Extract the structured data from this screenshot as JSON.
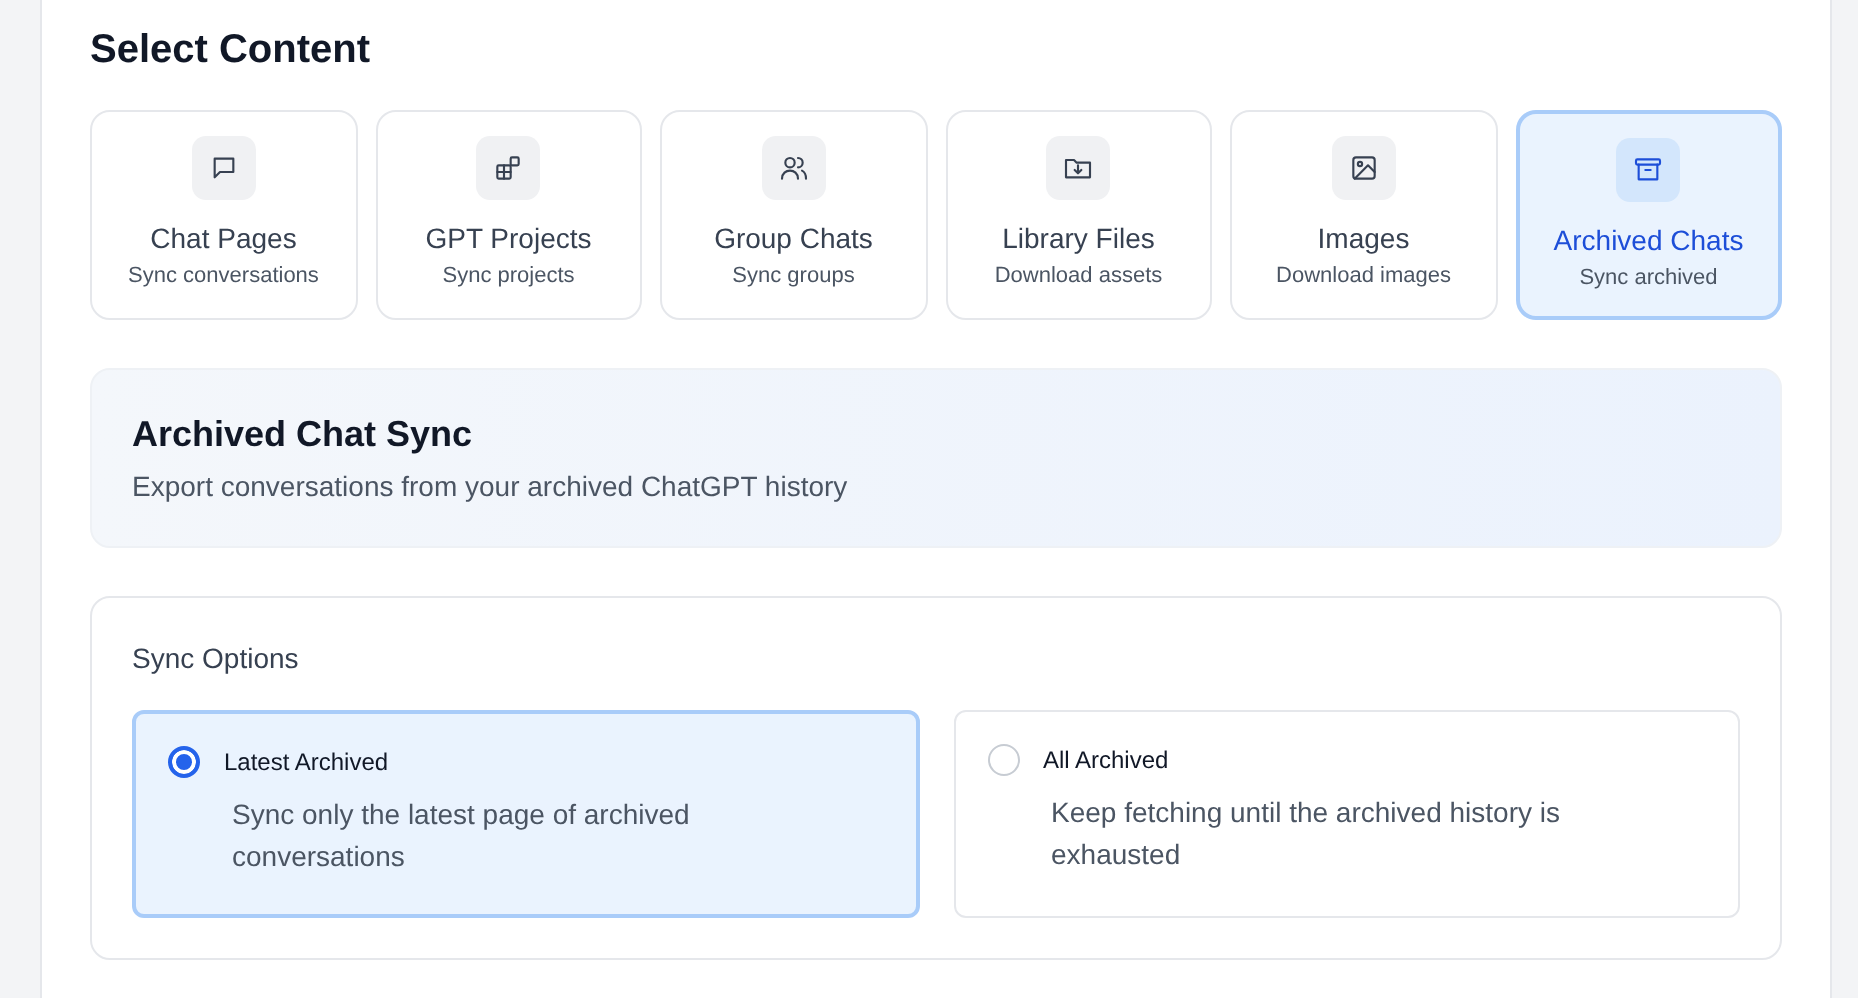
{
  "heading": "Select Content",
  "content_types": [
    {
      "kind": "chat",
      "label": "Chat Pages",
      "sub": "Sync conversations",
      "selected": false
    },
    {
      "kind": "projects",
      "label": "GPT Projects",
      "sub": "Sync projects",
      "selected": false
    },
    {
      "kind": "groups",
      "label": "Group Chats",
      "sub": "Sync groups",
      "selected": false
    },
    {
      "kind": "files",
      "label": "Library Files",
      "sub": "Download assets",
      "selected": false
    },
    {
      "kind": "images",
      "label": "Images",
      "sub": "Download images",
      "selected": false
    },
    {
      "kind": "archive",
      "label": "Archived Chats",
      "sub": "Sync archived",
      "selected": true
    }
  ],
  "info": {
    "title": "Archived Chat Sync",
    "description": "Export conversations from your archived ChatGPT history"
  },
  "sync_options": {
    "title": "Sync Options",
    "options": [
      {
        "label": "Latest Archived",
        "description": "Sync only the latest page of archived conversations",
        "selected": true
      },
      {
        "label": "All Archived",
        "description": "Keep fetching until the archived history is exhausted",
        "selected": false
      }
    ]
  }
}
